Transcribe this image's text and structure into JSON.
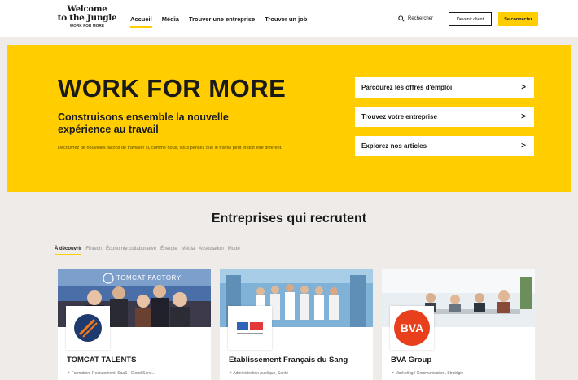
{
  "header": {
    "logo": {
      "line1": "Welcome",
      "line2": "to the Jungle",
      "line3": "WORK FOR MORE"
    },
    "nav": [
      {
        "label": "Accueil",
        "active": true
      },
      {
        "label": "Média",
        "active": false
      },
      {
        "label": "Trouver une entreprise",
        "active": false
      },
      {
        "label": "Trouver un job",
        "active": false
      }
    ],
    "search_label": "Rechercher",
    "client_button": "Devenir client",
    "login_button": "Se connecter"
  },
  "hero": {
    "title": "WORK FOR MORE",
    "subtitle": "Construisons ensemble la nouvelle expérience au travail",
    "description": "Découvrez de nouvelles façons de travailler si, comme nous, vous pensez que le travail peut et doit être différent.",
    "ctas": [
      {
        "label": "Parcourez les offres d'emploi"
      },
      {
        "label": "Trouvez votre entreprise"
      },
      {
        "label": "Explorez nos articles"
      }
    ],
    "arrow_glyph": ">"
  },
  "companies": {
    "title": "Entreprises qui recrutent",
    "tabs": [
      {
        "label": "À découvrir",
        "active": true
      },
      {
        "label": "Fintech",
        "active": false
      },
      {
        "label": "Économie collaborative",
        "active": false
      },
      {
        "label": "Énergie",
        "active": false
      },
      {
        "label": "Média",
        "active": false
      },
      {
        "label": "Association",
        "active": false
      },
      {
        "label": "Mode",
        "active": false
      }
    ],
    "cards": [
      {
        "name": "TOMCAT TALENTS",
        "tags": "Formation, Recrutement, SaaS / Cloud Servi...",
        "banner_text": "TOMCAT FACTORY"
      },
      {
        "name": "Etablissement Français du Sang",
        "tags": "Administration publique, Santé"
      },
      {
        "name": "BVA Group",
        "tags": "Marketing / Communication, Stratégie",
        "logo_text": "BVA"
      }
    ]
  },
  "colors": {
    "brand_yellow": "#ffcd00",
    "page_bg": "#efebe8",
    "tomcat_logo": "#1f3a6e",
    "tomcat_accent": "#f07a1a",
    "bva_red": "#e8401c"
  }
}
